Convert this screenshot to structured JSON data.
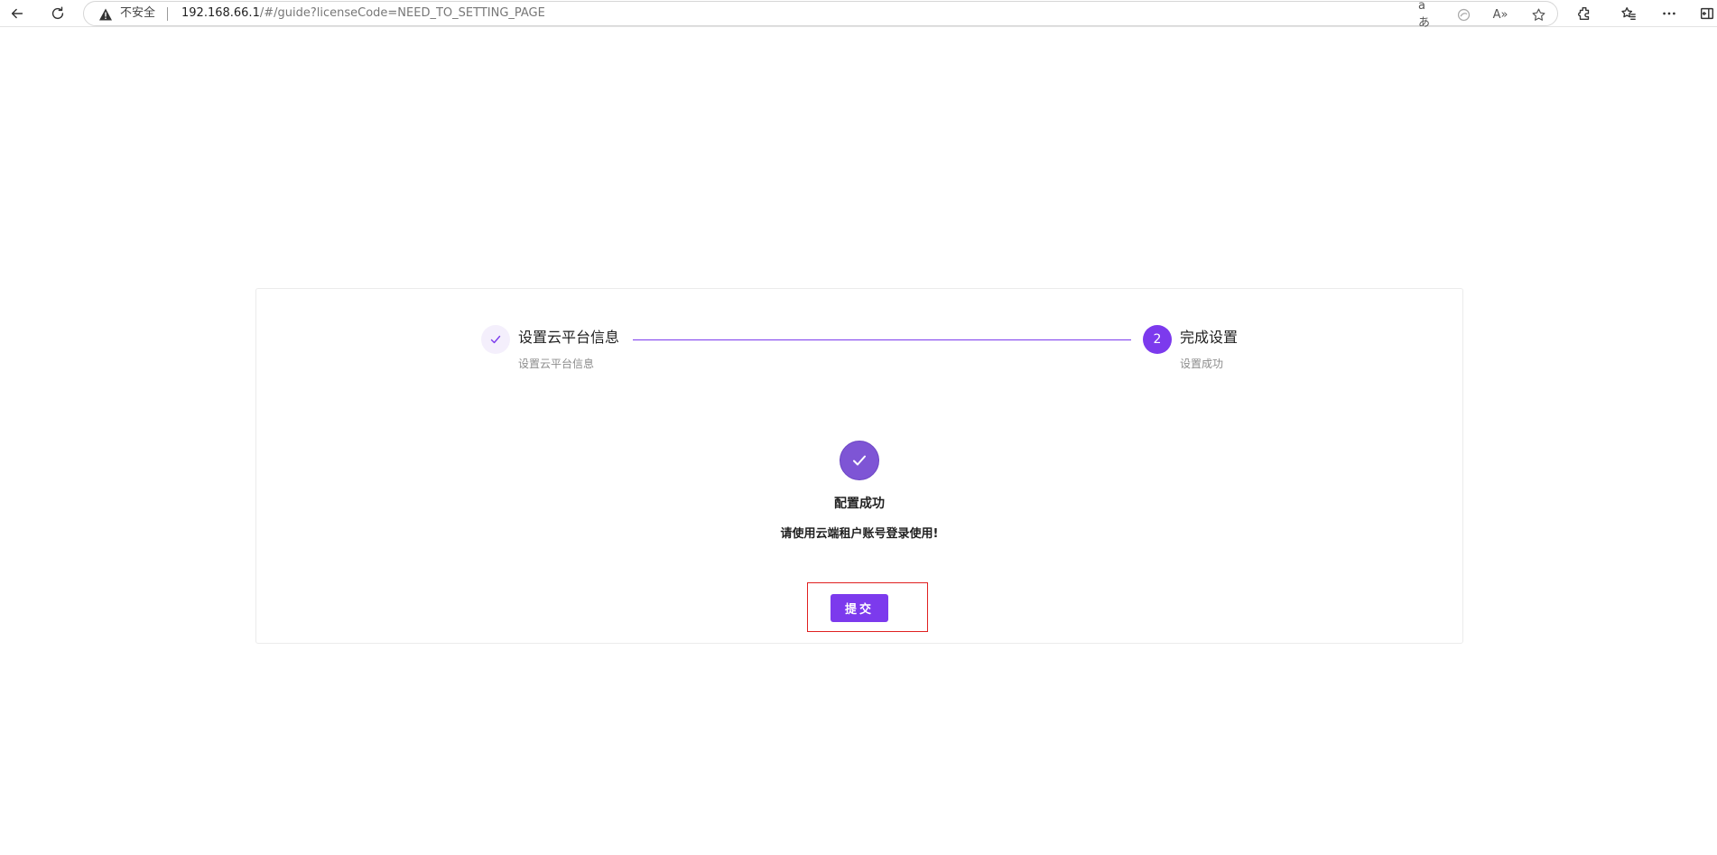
{
  "browser": {
    "insecure_label": "不安全",
    "url_host": "192.168.66.1",
    "url_path": "/#/guide?licenseCode=NEED_TO_SETTING_PAGE",
    "icons": {
      "back": "back-arrow-icon",
      "reload": "reload-icon",
      "warning": "warning-icon",
      "read_aloud": "read-aloud-icon",
      "translate": "translate-icon",
      "favorite": "star-icon",
      "extensions": "extensions-icon",
      "favorites": "favorites-icon",
      "more": "more-icon",
      "sidebar": "sidebar-icon"
    },
    "translate_glyph": "aあ",
    "read_aloud_glyph": "A»"
  },
  "steps": [
    {
      "index": "1",
      "title": "设置云平台信息",
      "description": "设置云平台信息",
      "status": "finished"
    },
    {
      "index": "2",
      "title": "完成设置",
      "description": "设置成功",
      "status": "current"
    }
  ],
  "result": {
    "title": "配置成功",
    "subtitle": "请使用云端租户账号登录使用!",
    "icon": "check-circle-icon"
  },
  "submit": {
    "label": "提交"
  },
  "colors": {
    "accent": "#7c3aed",
    "success_icon": "#7e55d5",
    "highlight_border": "#e02020",
    "step_done_bg": "#f4effc"
  }
}
